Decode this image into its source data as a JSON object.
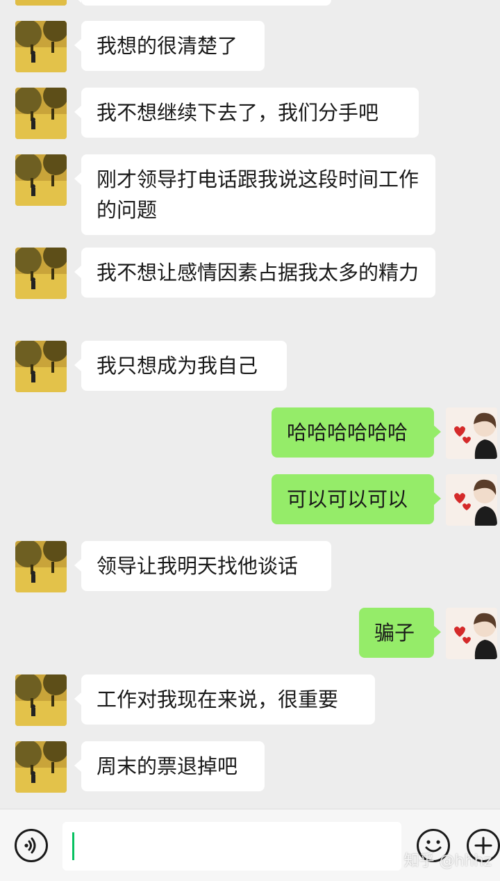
{
  "messages": [
    {
      "side": "in",
      "text": "我想的很清楚了"
    },
    {
      "side": "in",
      "text": "我不想继续下去了，我们分手吧"
    },
    {
      "side": "in",
      "text": "刚才领导打电话跟我说这段时间工作的问题"
    },
    {
      "side": "in",
      "text": "我不想让感情因素占据我太多的精力"
    },
    {
      "side": "in",
      "text": "我只想成为我自己"
    },
    {
      "side": "out",
      "text": "哈哈哈哈哈哈"
    },
    {
      "side": "out",
      "text": "可以可以可以"
    },
    {
      "side": "in",
      "text": "领导让我明天找他谈话"
    },
    {
      "side": "out",
      "text": "骗子"
    },
    {
      "side": "in",
      "text": "工作对我现在来说，很重要"
    },
    {
      "side": "in",
      "text": "周末的票退掉吧"
    }
  ],
  "input": {
    "value": ""
  },
  "icons": {
    "voice": "voice-icon",
    "emoji": "emoji-icon",
    "plus": "plus-icon"
  },
  "watermark": "知乎 @hhhz",
  "colors": {
    "incoming_bubble": "#ffffff",
    "outgoing_bubble": "#95ec69",
    "background": "#ededed",
    "cursor": "#07c160"
  }
}
